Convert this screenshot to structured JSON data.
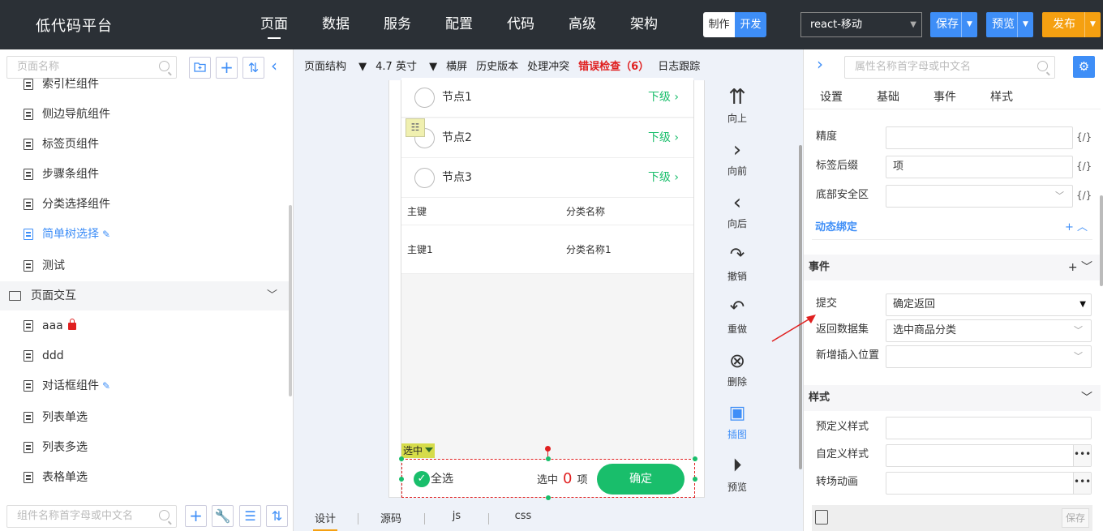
{
  "app": {
    "title": "低代码平台"
  },
  "nav": {
    "items": [
      "页面",
      "数据",
      "服务",
      "配置",
      "代码",
      "高级",
      "架构"
    ]
  },
  "mode": {
    "make": "制作",
    "dev": "开发"
  },
  "env": {
    "selected": "react-移动"
  },
  "actions": {
    "save": "保存",
    "preview": "预览",
    "publish": "发布"
  },
  "left": {
    "search_placeholder": "页面名称",
    "component_search_placeholder": "组件名称首字母或中文名",
    "items": [
      {
        "label": "索引栏组件"
      },
      {
        "label": "侧边导航组件"
      },
      {
        "label": "标签页组件"
      },
      {
        "label": "步骤条组件"
      },
      {
        "label": "分类选择组件"
      },
      {
        "label": "简单树选择"
      },
      {
        "label": "测试"
      },
      {
        "label": "页面交互"
      },
      {
        "label": "aaa"
      },
      {
        "label": "ddd"
      },
      {
        "label": "对话框组件"
      },
      {
        "label": "列表单选"
      },
      {
        "label": "列表多选"
      },
      {
        "label": "表格单选"
      }
    ]
  },
  "canvas": {
    "toolbar": {
      "structure": "页面结构",
      "size": "4.7 英寸",
      "landscape": "横屏",
      "history": "历史版本",
      "conflict": "处理冲突",
      "errors": "错误检查（6）",
      "log": "日志跟踪"
    },
    "nodes": [
      {
        "name": "节点1",
        "sub": "下级"
      },
      {
        "name": "节点2",
        "sub": "下级"
      },
      {
        "name": "节点3",
        "sub": "下级"
      }
    ],
    "table": {
      "headers": [
        "主键",
        "分类名称"
      ],
      "rows": [
        [
          "主键1",
          "分类名称1"
        ]
      ]
    },
    "selected_tag": "选中",
    "bottom": {
      "all": "全选",
      "selected_prefix": "选中",
      "count": "0",
      "unit": "项",
      "confirm": "确定"
    },
    "tools": [
      "向上",
      "向前",
      "向后",
      "撤销",
      "重做",
      "删除",
      "插图",
      "预览"
    ],
    "tabs": [
      "设计",
      "源码",
      "js",
      "css"
    ]
  },
  "right": {
    "search_placeholder": "属性名称首字母或中文名",
    "tabs": [
      "设置",
      "基础",
      "事件",
      "样式"
    ],
    "props": {
      "precision": {
        "label": "精度",
        "value": ""
      },
      "suffix": {
        "label": "标签后缀",
        "value": "项"
      },
      "safe_area": {
        "label": "底部安全区",
        "value": ""
      }
    },
    "dynamic_binding": "动态绑定",
    "events_section": "事件",
    "events": {
      "submit": {
        "label": "提交",
        "value": "确定返回"
      },
      "return_dataset": {
        "label": "返回数据集",
        "value": "选中商品分类"
      },
      "insert_position": {
        "label": "新增插入位置",
        "value": ""
      }
    },
    "style_section": "样式",
    "styles": {
      "predefined": {
        "label": "预定义样式"
      },
      "custom": {
        "label": "自定义样式"
      },
      "transition": {
        "label": "转场动画"
      }
    },
    "fx": "{/}",
    "footer_save": "保存"
  },
  "colors": {
    "accent": "#3e8ef7",
    "publish": "#f5a011",
    "success": "#19be6b",
    "error": "#e02020",
    "topbar": "#2b3036"
  }
}
